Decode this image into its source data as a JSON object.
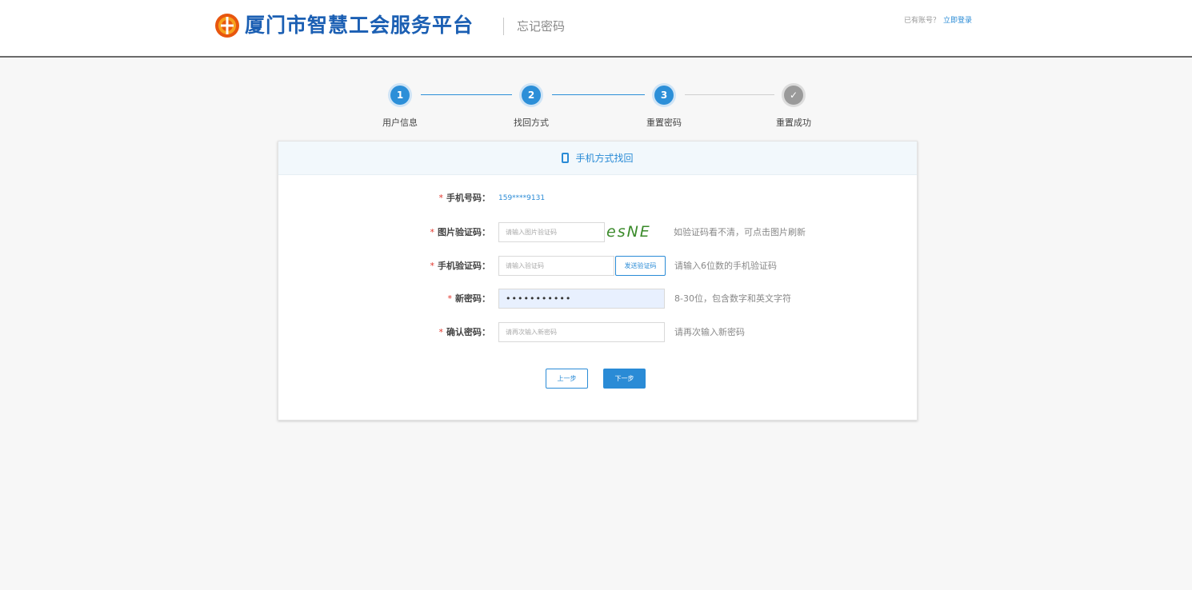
{
  "header": {
    "site_title": "厦门市智慧工会服务平台",
    "page_subtitle": "忘记密码",
    "account_prompt": "已有账号？",
    "login_link": "立即登录",
    "logo_color": "#e8560e"
  },
  "steps": [
    {
      "number": "1",
      "label": "用户信息",
      "state": "active"
    },
    {
      "number": "2",
      "label": "找回方式",
      "state": "active"
    },
    {
      "number": "3",
      "label": "重置密码",
      "state": "active"
    },
    {
      "number": "✓",
      "label": "重置成功",
      "state": "pending"
    }
  ],
  "card": {
    "title": "手机方式找回",
    "required_mark": "*",
    "phone": {
      "label": "手机号码：",
      "value": "159****9131"
    },
    "image_captcha": {
      "label": "图片验证码：",
      "placeholder": "请输入图片验证码",
      "captcha_text": "esNE",
      "hint": "如验证码看不清，可点击图片刷新"
    },
    "sms_code": {
      "label": "手机验证码：",
      "placeholder": "请输入验证码",
      "send_button": "发送验证码",
      "hint": "请输入6位数的手机验证码"
    },
    "new_password": {
      "label": "新密码：",
      "value": "•••••••••••",
      "hint": "8-30位，包含数字和英文字符"
    },
    "confirm_password": {
      "label": "确认密码：",
      "placeholder": "请再次输入新密码",
      "hint": "请再次输入新密码"
    },
    "prev_button": "上一步",
    "next_button": "下一步"
  },
  "colors": {
    "accent": "#2a8bd6",
    "title_blue": "#1b5fb3",
    "required": "#e0342a"
  }
}
